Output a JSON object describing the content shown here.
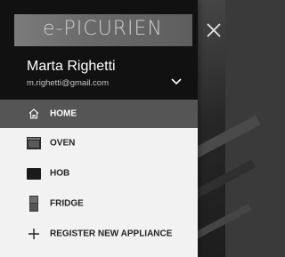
{
  "app": {
    "logo_text": "e-PICURIEN"
  },
  "user": {
    "name": "Marta Righetti",
    "email": "m.righetti@gmail.com"
  },
  "menu": {
    "items": [
      {
        "label": "HOME",
        "icon": "home-icon",
        "active": true
      },
      {
        "label": "OVEN",
        "icon": "oven-icon",
        "active": false
      },
      {
        "label": "HOB",
        "icon": "hob-icon",
        "active": false
      },
      {
        "label": "FRIDGE",
        "icon": "fridge-icon",
        "active": false
      },
      {
        "label": "REGISTER NEW APPLIANCE",
        "icon": "plus-icon",
        "active": false
      }
    ]
  },
  "colors": {
    "header_bg": "#111111",
    "active_item_bg": "#555555",
    "drawer_bg": "#f2f2f2"
  }
}
